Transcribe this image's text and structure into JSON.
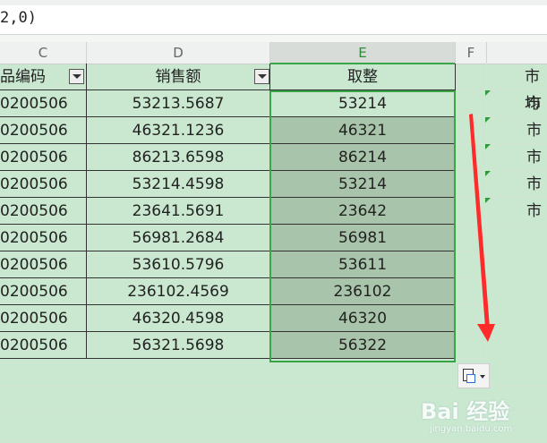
{
  "formula": {
    "text": "2,0)"
  },
  "columns": [
    {
      "id": "C",
      "label": "C"
    },
    {
      "id": "D",
      "label": "D"
    },
    {
      "id": "E",
      "label": "E"
    },
    {
      "id": "F",
      "label": "F"
    },
    {
      "id": "G",
      "label": ""
    }
  ],
  "header_row": {
    "c": "品编码",
    "d": "销售额",
    "e": "取整",
    "g": "市均"
  },
  "rows": [
    {
      "c": "0200506",
      "d": "53213.5687",
      "e": "53214",
      "g": "市"
    },
    {
      "c": "0200506",
      "d": "46321.1236",
      "e": "46321",
      "g": "市"
    },
    {
      "c": "0200506",
      "d": "86213.6598",
      "e": "86214",
      "g": "市"
    },
    {
      "c": "0200506",
      "d": "53214.4598",
      "e": "53214",
      "g": "市"
    },
    {
      "c": "0200506",
      "d": "23641.5691",
      "e": "23642",
      "g": "市"
    },
    {
      "c": "0200506",
      "d": "56981.2684",
      "e": "56981",
      "g": ""
    },
    {
      "c": "0200506",
      "d": "53610.5796",
      "e": "53611",
      "g": ""
    },
    {
      "c": "0200506",
      "d": "236102.4569",
      "e": "236102",
      "g": ""
    },
    {
      "c": "0200506",
      "d": "46320.4598",
      "e": "46320",
      "g": ""
    },
    {
      "c": "0200506",
      "d": "56321.5698",
      "e": "56322",
      "g": ""
    }
  ],
  "colors": {
    "accent": "#3aa547",
    "arrow": "#ff2a2a",
    "cell_bg": "#c9e8cf",
    "selected_bg": "#a8c4aa"
  },
  "watermark": {
    "text": "Bai 经验",
    "sub": "jingyan.baidu.com"
  }
}
